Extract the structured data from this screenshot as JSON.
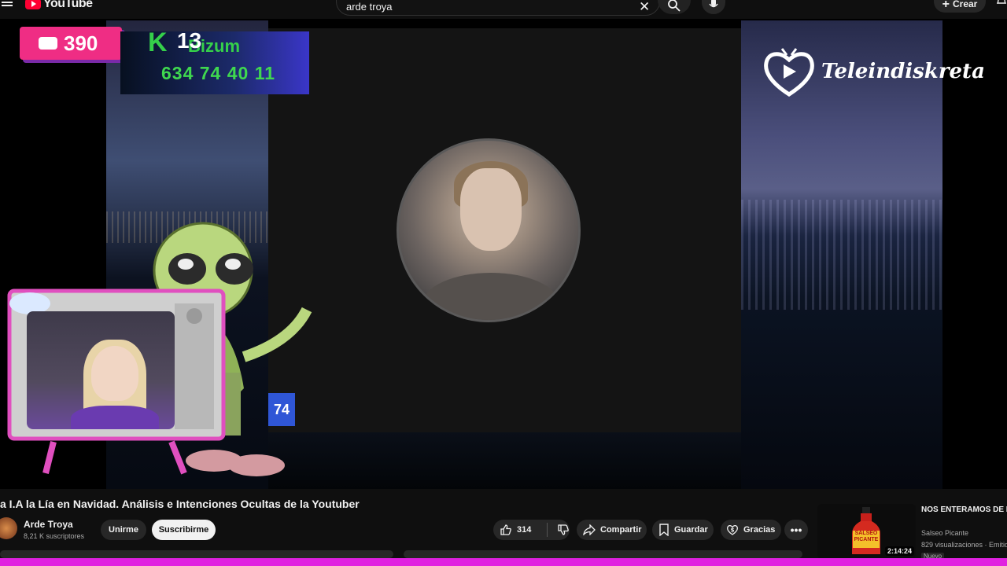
{
  "header": {
    "logo_text": "YouTube",
    "search_value": "arde troya",
    "create_label": "Crear"
  },
  "video": {
    "counter_value": "390",
    "bizum": {
      "k_letter": "K",
      "code": "13",
      "word": "Bizum",
      "phone": "634 74 40 11"
    },
    "brand_text": "Teleindiskreta",
    "side_tag": "74"
  },
  "watch": {
    "title": "a I.A la Lía en Navidad. Análisis e Intenciones Ocultas de la Youtuber",
    "channel_name": "Arde Troya",
    "subscribers": "8,21 K suscriptores",
    "join_label": "Unirme",
    "subscribe_label": "Suscribirme",
    "like_count": "314",
    "share_label": "Compartir",
    "save_label": "Guardar",
    "thanks_label": "Gracias",
    "more_label": "•••"
  },
  "recommended": {
    "title": "NOS ENTERAMOS DE LO RECIENTE DEL SALSEO",
    "channel": "Salseo Picante",
    "meta": "829 visualizaciones · Emitido",
    "badge": "Nuevo",
    "duration": "2:14:24",
    "thumb_text": "SALSEO PICANTE"
  },
  "colors": {
    "accent_red": "#ff0033",
    "counter_pink": "#ef2d84",
    "bizum_green": "#35d04a",
    "bottom_bar_magenta": "#e021e0"
  }
}
